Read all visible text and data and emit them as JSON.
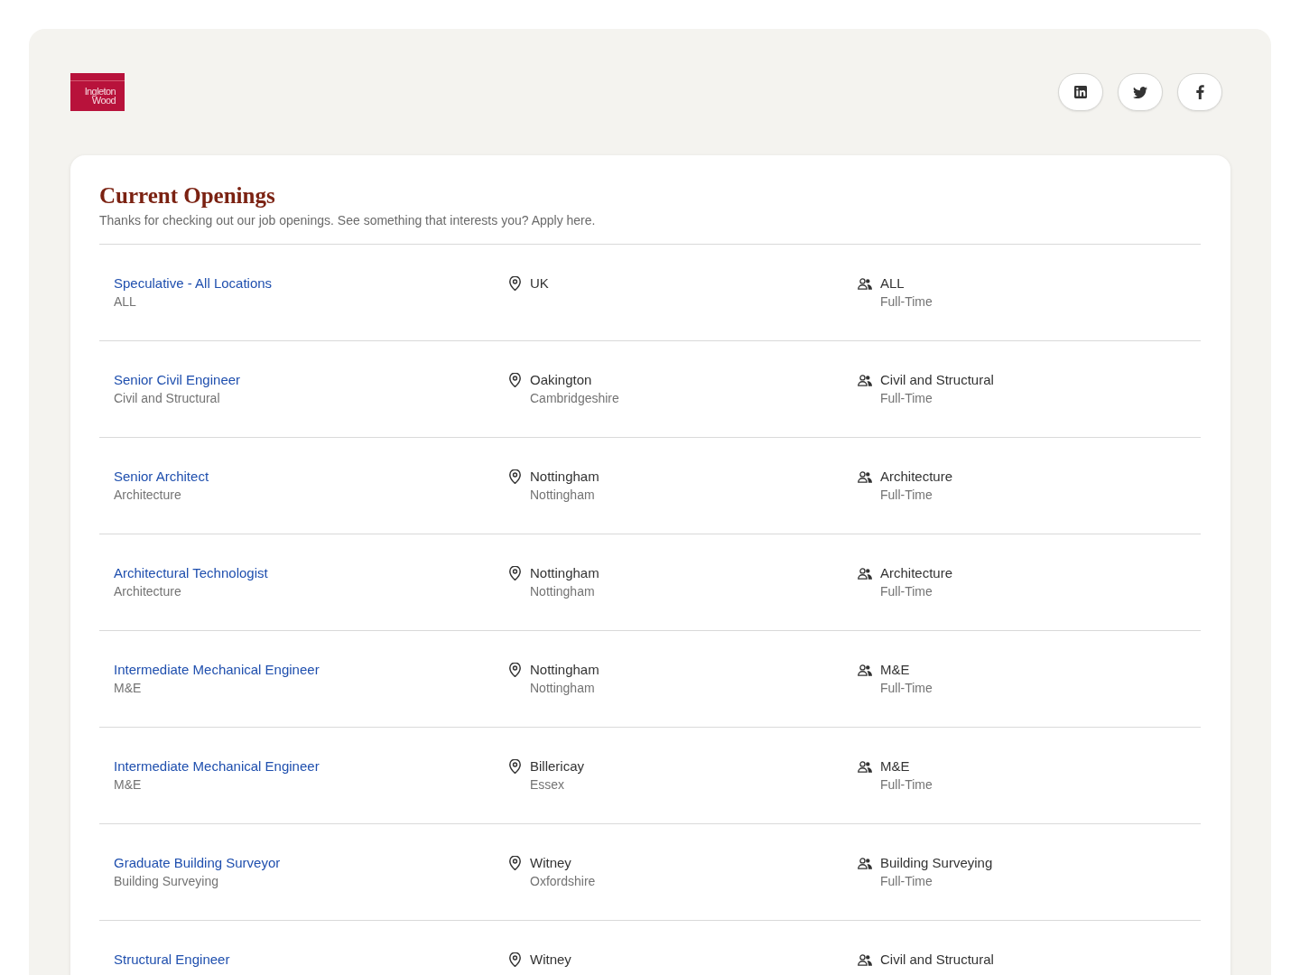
{
  "logo": {
    "text": "Ingleton Wood"
  },
  "social_links": [
    {
      "kind": "in-square"
    },
    {
      "kind": "bird"
    },
    {
      "kind": "letter-f"
    }
  ],
  "heading": "Current Openings",
  "intro": "Thanks for checking out our job openings. See something that interests you? Apply here.",
  "jobs": [
    {
      "title": "Speculative - All Locations",
      "department": "ALL",
      "location": {
        "city": "UK"
      },
      "team": "ALL",
      "type": "Full-Time"
    },
    {
      "title": "Senior Civil Engineer",
      "department": "Civil and Structural",
      "location": {
        "city": "Oakington",
        "region": "Cambridgeshire"
      },
      "team": "Civil and Structural",
      "type": "Full-Time"
    },
    {
      "title": "Senior Architect",
      "department": "Architecture",
      "location": {
        "city": "Nottingham",
        "region": "Nottingham"
      },
      "team": "Architecture",
      "type": "Full-Time"
    },
    {
      "title": "Architectural Technologist",
      "department": "Architecture",
      "location": {
        "city": "Nottingham",
        "region": "Nottingham"
      },
      "team": "Architecture",
      "type": "Full-Time"
    },
    {
      "title": "Intermediate Mechanical Engineer",
      "department": "M&E",
      "location": {
        "city": "Nottingham",
        "region": "Nottingham"
      },
      "team": "M&E",
      "type": "Full-Time"
    },
    {
      "title": "Intermediate Mechanical Engineer",
      "department": "M&E",
      "location": {
        "city": "Billericay",
        "region": "Essex"
      },
      "team": "M&E",
      "type": "Full-Time"
    },
    {
      "title": "Graduate Building Surveyor",
      "department": "Building Surveying",
      "location": {
        "city": "Witney",
        "region": "Oxfordshire"
      },
      "team": "Building Surveying",
      "type": "Full-Time"
    },
    {
      "title": "Structural Engineer",
      "location": {
        "city": "Witney"
      },
      "team": "Civil and Structural"
    }
  ]
}
